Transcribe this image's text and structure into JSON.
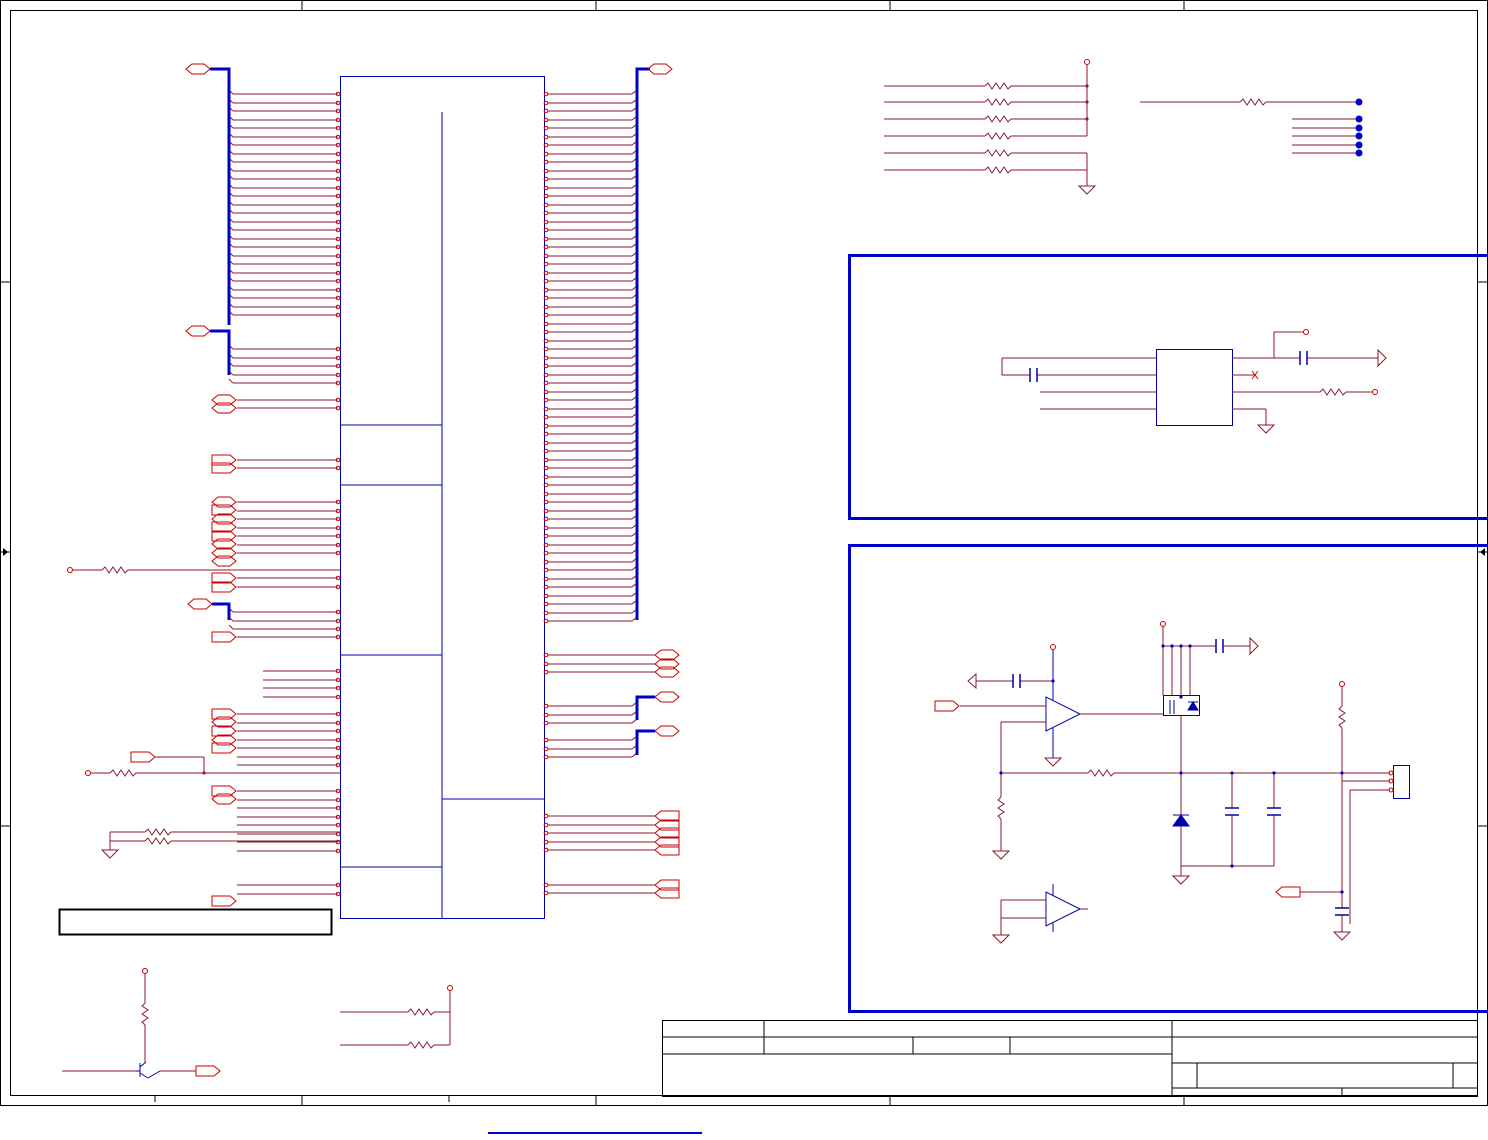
{
  "schematic": {
    "colors": {
      "wire": "#8b1a2e",
      "bus": "#0000cc",
      "part": "#0000aa",
      "frame": "#000000",
      "pin": "#cc0000",
      "junction": "#0000cc"
    },
    "title_block": {
      "fields": [
        "",
        "",
        "",
        "",
        "",
        "",
        ""
      ]
    }
  }
}
